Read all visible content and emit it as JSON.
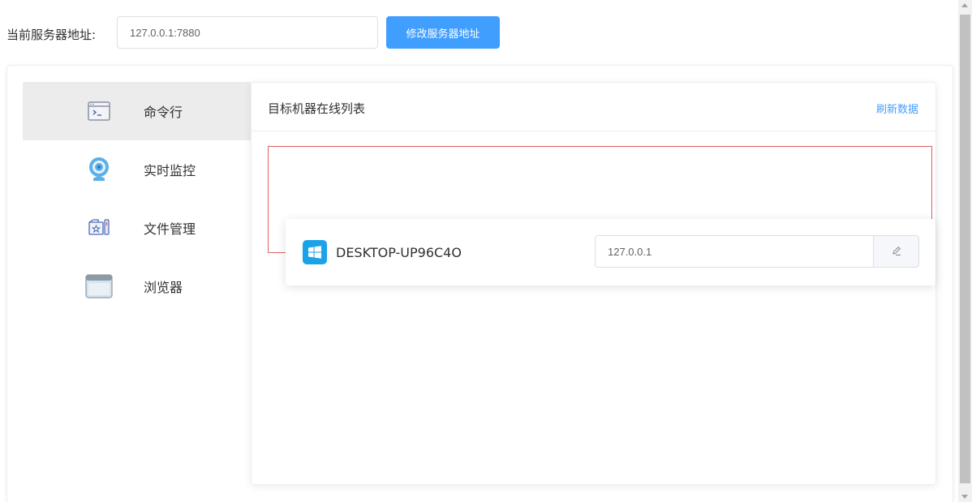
{
  "server": {
    "label": "当前服务器地址:",
    "address": "127.0.0.1:7880",
    "change_button": "修改服务器地址"
  },
  "sidebar": {
    "items": [
      {
        "label": "命令行",
        "icon": "terminal-icon",
        "active": true
      },
      {
        "label": "实时监控",
        "icon": "webcam-icon",
        "active": false
      },
      {
        "label": "文件管理",
        "icon": "file-manager-icon",
        "active": false
      },
      {
        "label": "浏览器",
        "icon": "browser-window-icon",
        "active": false
      }
    ]
  },
  "panel": {
    "title": "目标机器在线列表",
    "refresh": "刷新数据",
    "machines": [
      {
        "name": "DESKTOP-UP96C4O",
        "ip": "127.0.0.1",
        "os_icon": "windows-logo-icon"
      }
    ]
  },
  "colors": {
    "accent": "#409eff",
    "active_bg": "#ececec",
    "highlight_border": "#e06060",
    "windows_blue": "#1aa3e8"
  }
}
